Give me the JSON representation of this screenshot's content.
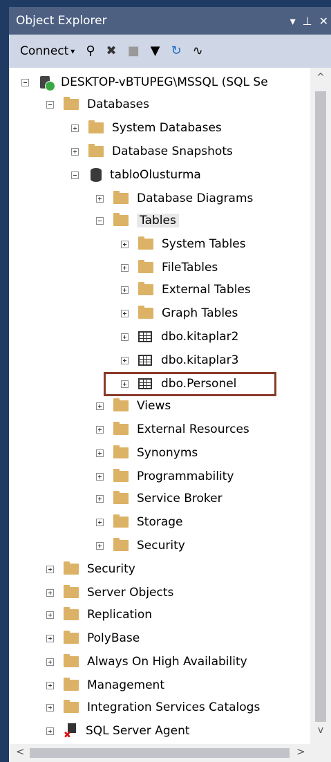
{
  "panel": {
    "title": "Object Explorer",
    "ctrl_dropdown": "▾",
    "ctrl_pin": "ᚒ",
    "ctrl_close": "✕"
  },
  "toolbar": {
    "connect_label": "Connect",
    "connect_caret": "▾",
    "icons": [
      "connect-plug-icon",
      "disconnect-icon",
      "stop-icon",
      "filter-icon",
      "refresh-icon",
      "activity-monitor-icon"
    ]
  },
  "tree": {
    "server": "DESKTOP-vBTUPEG\\MSSQL (SQL Se",
    "databases": "Databases",
    "system_databases": "System Databases",
    "database_snapshots": "Database Snapshots",
    "db_name": "tabloOlusturma",
    "database_diagrams": "Database Diagrams",
    "tables": "Tables",
    "system_tables": "System Tables",
    "file_tables": "FileTables",
    "external_tables": "External Tables",
    "graph_tables": "Graph Tables",
    "table1": "dbo.kitaplar2",
    "table2": "dbo.kitaplar3",
    "table3": "dbo.Personel",
    "views": "Views",
    "external_resources": "External Resources",
    "synonyms": "Synonyms",
    "programmability": "Programmability",
    "service_broker": "Service Broker",
    "db_storage": "Storage",
    "db_security": "Security",
    "security": "Security",
    "server_objects": "Server Objects",
    "replication": "Replication",
    "polybase": "PolyBase",
    "always_on": "Always On High Availability",
    "management": "Management",
    "integration_services": "Integration Services Catalogs",
    "sql_agent": "SQL Server Agent"
  },
  "scroll": {
    "up": "^",
    "down": "v",
    "left": "<",
    "right": ">"
  },
  "colors": {
    "titlebar": "#4d6082",
    "frame": "#1f3a63",
    "toolbar": "#cfd6e5",
    "highlight_box": "#8b3a2b",
    "folder": "#dcb266"
  }
}
